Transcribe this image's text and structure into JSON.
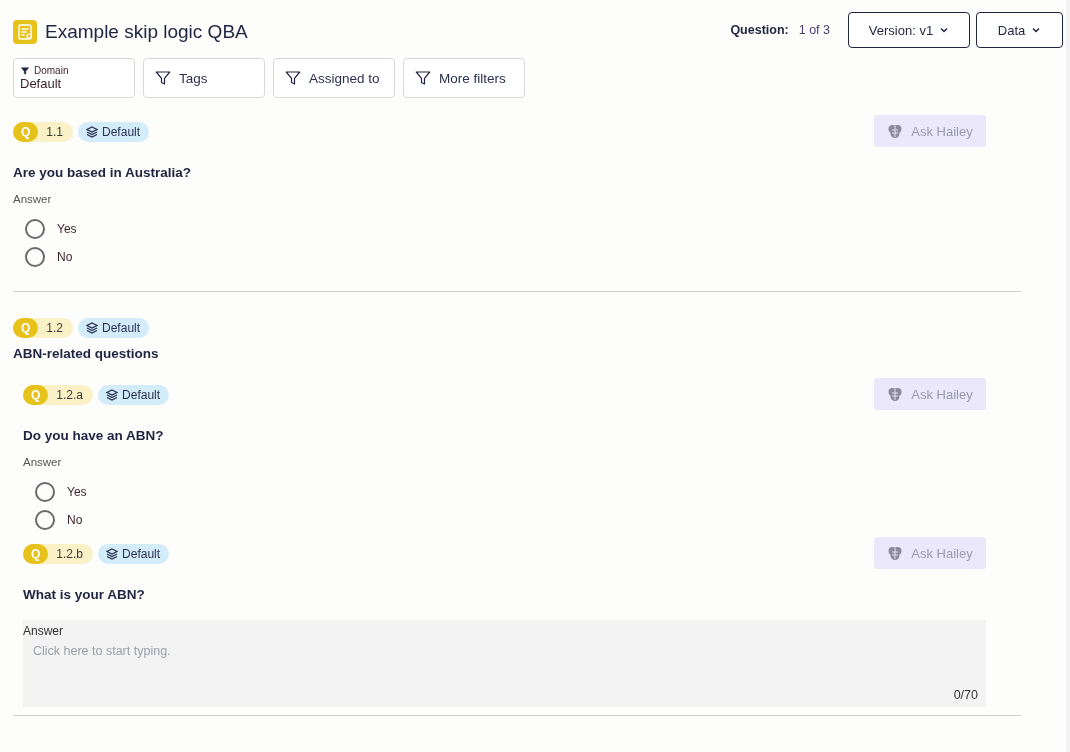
{
  "header": {
    "title": "Example skip logic QBA",
    "question_label": "Question:",
    "question_count": "1 of 3",
    "version_button": "Version: v1",
    "data_button": "Data"
  },
  "filters": [
    {
      "kind": "labeled",
      "label": "Domain",
      "value": "Default"
    },
    {
      "kind": "plain",
      "label": "Tags"
    },
    {
      "kind": "plain",
      "label": "Assigned to"
    },
    {
      "kind": "plain",
      "label": "More filters"
    }
  ],
  "questions": [
    {
      "kind": "choice",
      "badge": "Q",
      "number": "1.1",
      "tag": "Default",
      "ask_button": "Ask Hailey",
      "title": "Are you based in Australia?",
      "answer_label": "Answer",
      "options": [
        {
          "label": "Yes",
          "selected": false
        },
        {
          "label": "No",
          "selected": false
        }
      ]
    },
    {
      "kind": "group",
      "badge": "Q",
      "number": "1.2",
      "tag": "Default",
      "title": "ABN-related questions",
      "children": [
        {
          "kind": "choice",
          "badge": "Q",
          "number": "1.2.a",
          "tag": "Default",
          "ask_button": "Ask Hailey",
          "title": "Do you have an ABN?",
          "answer_label": "Answer",
          "options": [
            {
              "label": "Yes",
              "selected": false
            },
            {
              "label": "No",
              "selected": false
            }
          ]
        },
        {
          "kind": "text",
          "badge": "Q",
          "number": "1.2.b",
          "tag": "Default",
          "ask_button": "Ask Hailey",
          "title": "What is your ABN?",
          "answer_label": "Answer",
          "placeholder": "Click here to start typing.",
          "counter": "0/70"
        }
      ]
    }
  ]
}
